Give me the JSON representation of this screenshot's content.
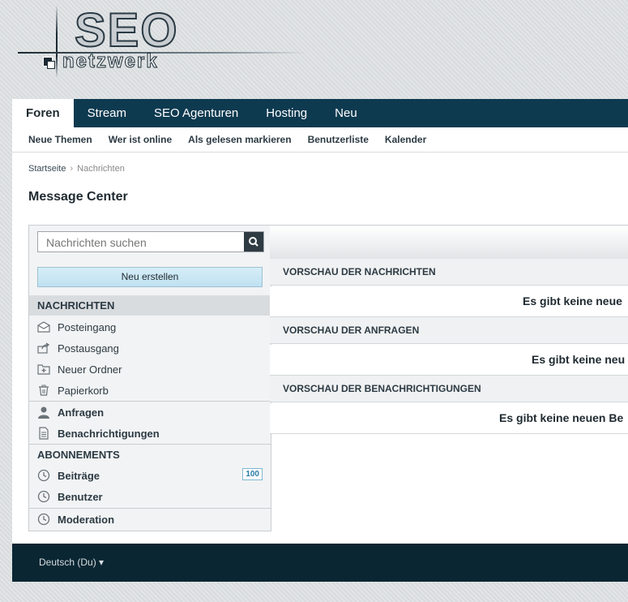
{
  "logo": {
    "word1": "SEO",
    "word2": "netzwerk"
  },
  "nav": {
    "tabs": [
      "Foren",
      "Stream",
      "SEO Agenturen",
      "Hosting",
      "Neu"
    ]
  },
  "subnav": {
    "items": [
      "Neue Themen",
      "Wer ist online",
      "Als gelesen markieren",
      "Benutzerliste",
      "Kalender"
    ]
  },
  "breadcrumb": {
    "home": "Startseite",
    "current": "Nachrichten"
  },
  "page_title": "Message Center",
  "sidebar": {
    "search_placeholder": "Nachrichten suchen",
    "new_button": "Neu erstellen",
    "section_messages": "NACHRICHTEN",
    "items": [
      "Posteingang",
      "Postausgang",
      "Neuer Ordner",
      "Papierkorb"
    ],
    "requests": "Anfragen",
    "notifications": "Benachrichtigungen",
    "section_subscriptions": "ABONNEMENTS",
    "posts": "Beiträge",
    "posts_badge": "100",
    "users": "Benutzer",
    "moderation": "Moderation"
  },
  "main": {
    "sections": [
      {
        "title": "VORSCHAU DER NACHRICHTEN",
        "empty": "Es gibt keine neue"
      },
      {
        "title": "VORSCHAU DER ANFRAGEN",
        "empty": "Es gibt keine neu"
      },
      {
        "title": "VORSCHAU DER BENACHRICHTIGUNGEN",
        "empty": "Es gibt keine neuen Be"
      }
    ]
  },
  "footer": {
    "language": "Deutsch (Du) ▾"
  },
  "colors": {
    "nav": "#0e3a50",
    "footer": "#0a2633",
    "button": "#bfe1f1",
    "badge": "#2a7aa6"
  }
}
